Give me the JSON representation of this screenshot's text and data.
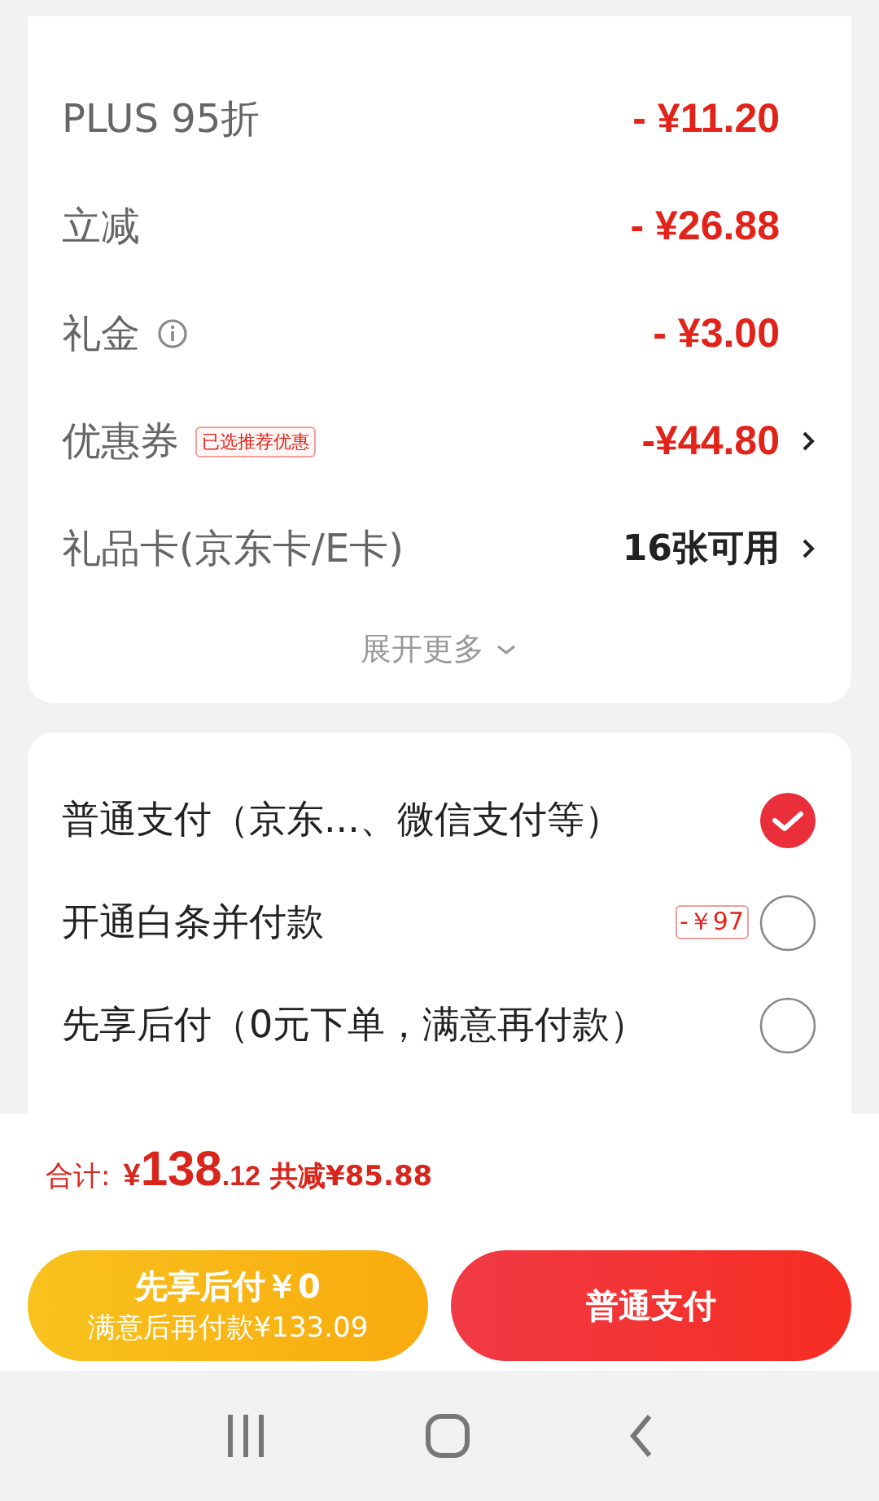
{
  "price_rows": [
    {
      "label": "PLUS 95折",
      "value": "- ¥11.20",
      "kind": "discount"
    },
    {
      "label": "立减",
      "value": "- ¥26.88",
      "kind": "discount"
    },
    {
      "label": "礼金",
      "value": "- ¥3.00",
      "kind": "discount",
      "info": true
    },
    {
      "label": "优惠券",
      "tag": "已选推荐优惠",
      "value": "-¥44.80",
      "kind": "discount",
      "link": true
    },
    {
      "label": "礼品卡(京东卡/E卡)",
      "value": "16张可用",
      "kind": "plain",
      "link": true
    }
  ],
  "expand_more": "展开更多",
  "payment_options": [
    {
      "label": "普通支付（京东...、微信支付等）",
      "selected": true
    },
    {
      "label": "开通白条并付款",
      "tag": "-￥97",
      "selected": false
    },
    {
      "label": "先享后付（0元下单，满意再付款）",
      "selected": false
    }
  ],
  "total": {
    "label": "合计:",
    "currency": "¥",
    "integer": "138",
    "decimal": ".12",
    "saving": "共减¥85.88"
  },
  "buttons": [
    {
      "kind": "later",
      "title": "先享后付￥0",
      "subtitle": "满意后再付款¥133.09"
    },
    {
      "kind": "normal",
      "title": "普通支付"
    }
  ]
}
